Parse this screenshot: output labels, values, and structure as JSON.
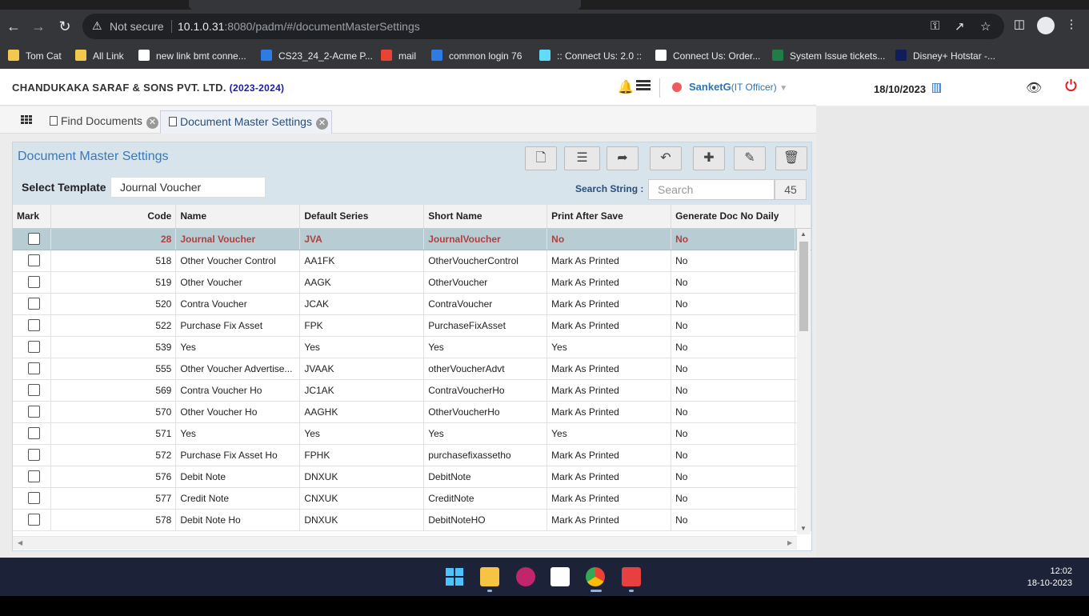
{
  "browser": {
    "security_label": "Not secure",
    "url_host": "10.1.0.31",
    "url_rest": ":8080/padm/#/documentMasterSettings"
  },
  "bookmarks": [
    {
      "label": "Tom Cat",
      "color": "#f2c94c"
    },
    {
      "label": "All Link",
      "color": "#f2c94c"
    },
    {
      "label": "new link bmt conne...",
      "color": "#ffffff"
    },
    {
      "label": "CS23_24_2-Acme P...",
      "color": "#2d7be5"
    },
    {
      "label": "mail",
      "color": "#ea4335"
    },
    {
      "label": "common login 76",
      "color": "#2d7be5"
    },
    {
      "label": ":: Connect Us: 2.0 ::",
      "color": "#61dafb"
    },
    {
      "label": "Connect Us: Order...",
      "color": "#ffffff"
    },
    {
      "label": "System Issue tickets...",
      "color": "#1e7e45"
    },
    {
      "label": "Disney+ Hotstar -...",
      "color": "#0f1e5a"
    }
  ],
  "header": {
    "company": "CHANDUKAKA SARAF & SONS PVT. LTD.",
    "year": "(2023-2024)",
    "user": "SanketG",
    "role": "(IT Officer)",
    "date": "18/10/2023"
  },
  "tabs": [
    {
      "label": "Find Documents"
    },
    {
      "label": "Document Master Settings"
    }
  ],
  "panel": {
    "title": "Document Master Settings",
    "select_label": "Select Template",
    "select_value": "Journal Voucher",
    "search_label": "Search String :",
    "search_placeholder": "Search",
    "search_count": "45"
  },
  "table": {
    "headers": [
      "Mark",
      "Code",
      "Name",
      "Default Series",
      "Short Name",
      "Print After Save",
      "Generate Doc No Daily"
    ],
    "rows": [
      {
        "code": "28",
        "name": "Journal Voucher",
        "series": "JVA",
        "short": "JournalVoucher",
        "print": "No",
        "daily": "No"
      },
      {
        "code": "518",
        "name": "Other Voucher Control",
        "series": "AA1FK",
        "short": "OtherVoucherControl",
        "print": "Mark As Printed",
        "daily": "No"
      },
      {
        "code": "519",
        "name": "Other Voucher",
        "series": "AAGK",
        "short": "OtherVoucher",
        "print": "Mark As Printed",
        "daily": "No"
      },
      {
        "code": "520",
        "name": "Contra Voucher",
        "series": "JCAK",
        "short": "ContraVoucher",
        "print": "Mark As Printed",
        "daily": "No"
      },
      {
        "code": "522",
        "name": "Purchase Fix Asset",
        "series": "FPK",
        "short": "PurchaseFixAsset",
        "print": "Mark As Printed",
        "daily": "No"
      },
      {
        "code": "539",
        "name": "Yes",
        "series": "Yes",
        "short": "Yes",
        "print": "Yes",
        "daily": "No"
      },
      {
        "code": "555",
        "name": "Other Voucher Advertise...",
        "series": "JVAAK",
        "short": "otherVoucherAdvt",
        "print": "Mark As Printed",
        "daily": "No"
      },
      {
        "code": "569",
        "name": "Contra Voucher Ho",
        "series": "JC1AK",
        "short": "ContraVoucherHo",
        "print": "Mark As Printed",
        "daily": "No"
      },
      {
        "code": "570",
        "name": "Other Voucher Ho",
        "series": "AAGHK",
        "short": "OtherVoucherHo",
        "print": "Mark As Printed",
        "daily": "No"
      },
      {
        "code": "571",
        "name": "Yes",
        "series": "Yes",
        "short": "Yes",
        "print": "Yes",
        "daily": "No"
      },
      {
        "code": "572",
        "name": "Purchase Fix Asset Ho",
        "series": "FPHK",
        "short": "purchasefixassetho",
        "print": "Mark As Printed",
        "daily": "No"
      },
      {
        "code": "576",
        "name": "Debit Note",
        "series": "DNXUK",
        "short": "DebitNote",
        "print": "Mark As Printed",
        "daily": "No"
      },
      {
        "code": "577",
        "name": "Credit Note",
        "series": "CNXUK",
        "short": "CreditNote",
        "print": "Mark As Printed",
        "daily": "No"
      },
      {
        "code": "578",
        "name": "Debit Note Ho",
        "series": "DNXUK",
        "short": "DebitNoteHO",
        "print": "Mark As Printed",
        "daily": "No"
      }
    ]
  },
  "taskbar": {
    "time": "12:02",
    "date": "18-10-2023"
  },
  "colors": {
    "accent": "#3a78b8",
    "selected_row_bg": "#b7ccd3",
    "selected_row_text": "#b04040",
    "status_dot": "#ef5b5b"
  }
}
